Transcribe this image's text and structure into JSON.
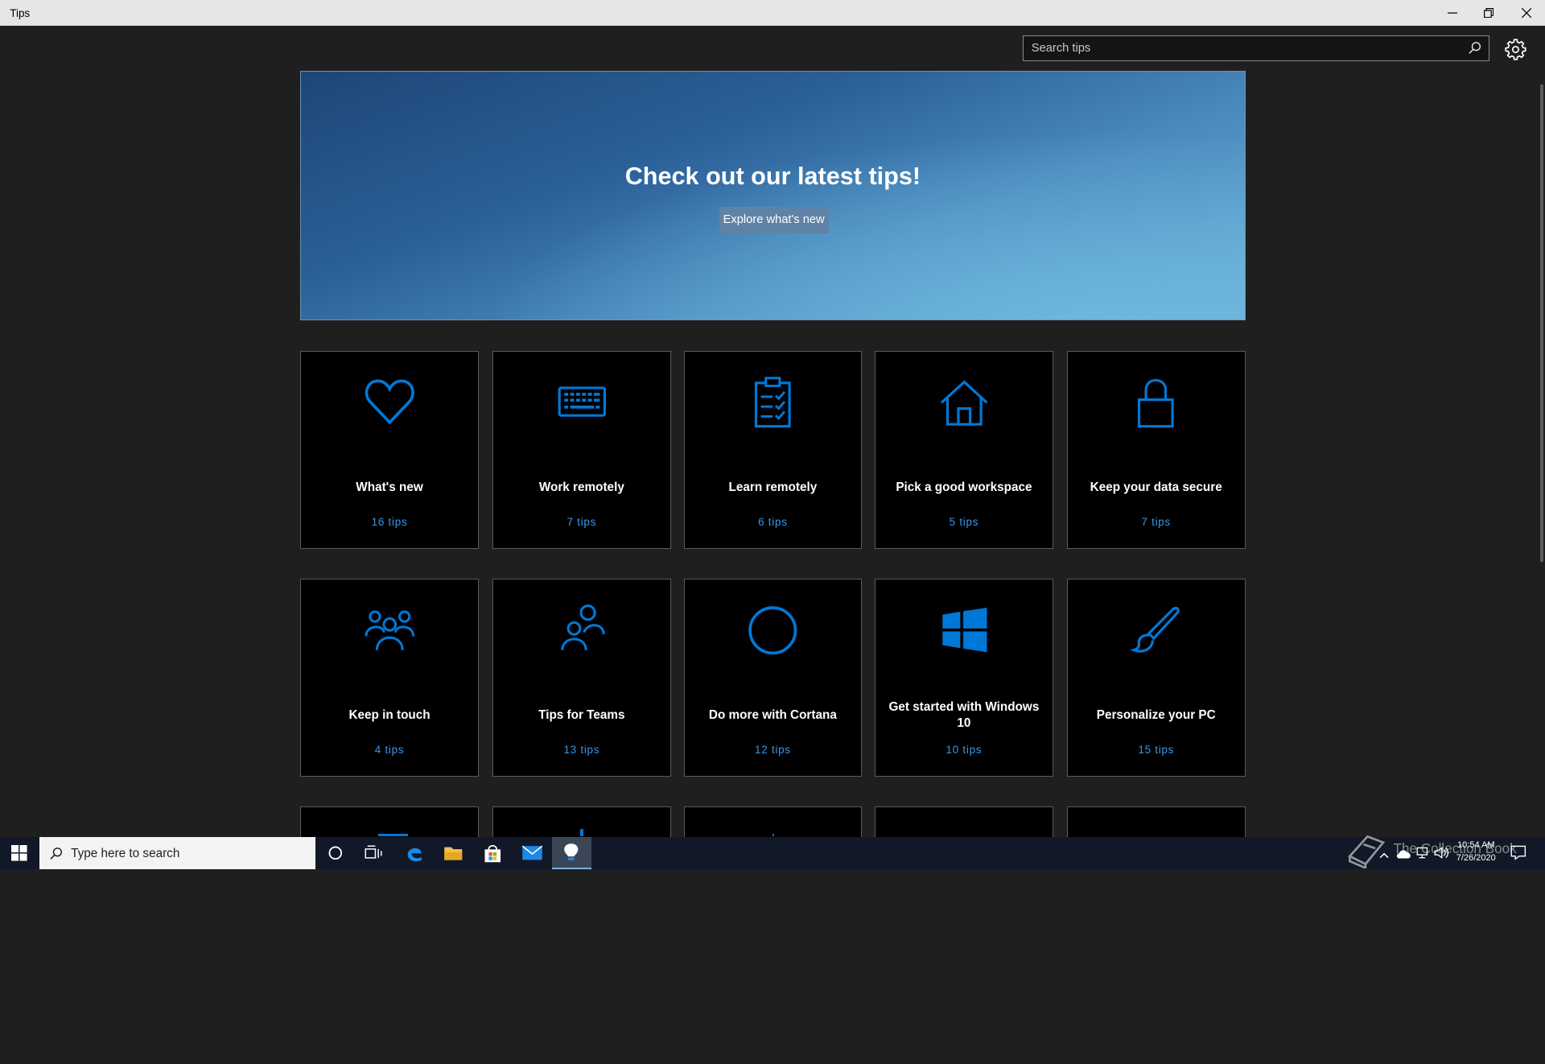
{
  "window": {
    "title": "Tips"
  },
  "search": {
    "placeholder": "Search tips"
  },
  "hero": {
    "heading": "Check out our latest tips!",
    "button": "Explore what's new"
  },
  "cards": [
    {
      "title": "What's new",
      "count": "16 tips",
      "icon": "heart-icon"
    },
    {
      "title": "Work remotely",
      "count": "7 tips",
      "icon": "keyboard-icon"
    },
    {
      "title": "Learn remotely",
      "count": "6 tips",
      "icon": "clipboard-checklist-icon"
    },
    {
      "title": "Pick a good workspace",
      "count": "5 tips",
      "icon": "home-icon"
    },
    {
      "title": "Keep your data secure",
      "count": "7 tips",
      "icon": "lock-icon"
    },
    {
      "title": "Keep in touch",
      "count": "4 tips",
      "icon": "people-group-icon"
    },
    {
      "title": "Tips for Teams",
      "count": "13 tips",
      "icon": "team-people-icon"
    },
    {
      "title": "Do more with Cortana",
      "count": "12 tips",
      "icon": "cortana-circle-icon"
    },
    {
      "title": "Get started with Windows 10",
      "count": "10 tips",
      "icon": "windows-logo-icon"
    },
    {
      "title": "Personalize your PC",
      "count": "15 tips",
      "icon": "paintbrush-icon"
    }
  ],
  "taskbar": {
    "search_text": "Type here to search",
    "time": "10:54 AM",
    "date": "7/26/2020",
    "watermark": "The Collection Book"
  },
  "colors": {
    "accent": "#0078d7",
    "tips_count": "#3a96e8",
    "background": "#1f1f1f"
  }
}
